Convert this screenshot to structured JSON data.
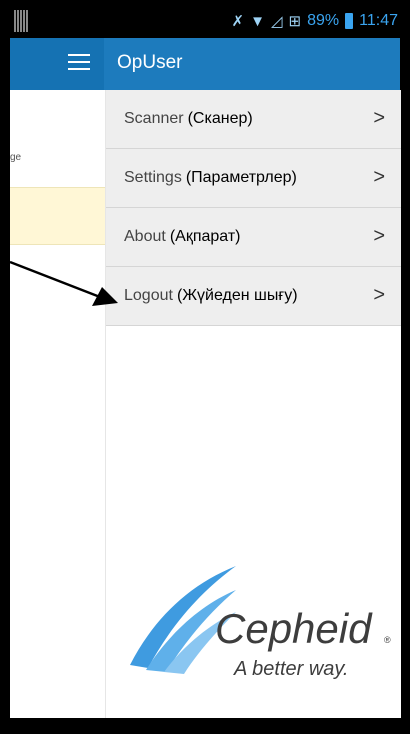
{
  "status_bar": {
    "battery": "89%",
    "time": "11:47",
    "icons": [
      "mute-icon",
      "wifi-icon",
      "signal-icon",
      "network-icon",
      "battery-icon"
    ]
  },
  "app_bar": {
    "title": "OpUser"
  },
  "background_screen": {
    "snippet": "ge"
  },
  "drawer": {
    "items": [
      {
        "label_en": "Scanner",
        "label_kk": "(Сканер)"
      },
      {
        "label_en": "Settings",
        "label_kk": "(Параметрлер)"
      },
      {
        "label_en": "About",
        "label_kk": "(Ақпарат)"
      },
      {
        "label_en": "Logout",
        "label_kk": "(Жүйеден шығу)"
      }
    ]
  },
  "logo": {
    "name": "Cepheid",
    "registered": "®",
    "tagline": "A better way."
  },
  "colors": {
    "app_bar": "#1d7bbd",
    "status_text": "#3aa4f0",
    "logo_stripes": "#3f9be0"
  }
}
